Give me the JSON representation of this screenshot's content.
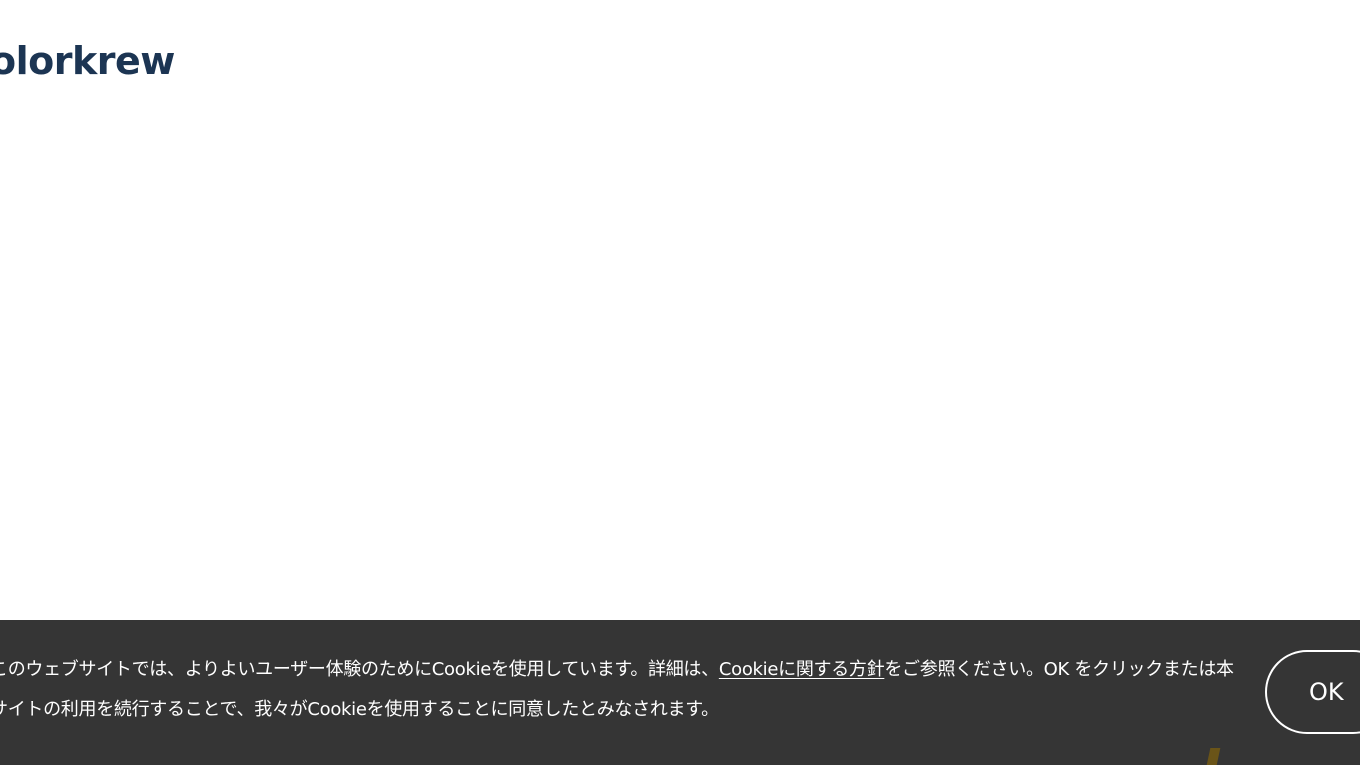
{
  "header": {
    "logo_text": "olorkrew"
  },
  "cookie_banner": {
    "text_before_link": "このウェブサイトでは、よりよいユーザー体験のためにCookieを使用しています。詳細は、",
    "link_label": "Cookieに関する方針",
    "text_after_link": "をご参照ください。OK をクリックまたは本サイトの利用を続行することで、我々がCookieを使用することに同意したとみなされます。",
    "ok_label": "OK"
  },
  "colors": {
    "logo": "#1c3553",
    "banner_background": "#353535",
    "banner_text": "#ffffff",
    "decor_mark": "#6a5418"
  }
}
